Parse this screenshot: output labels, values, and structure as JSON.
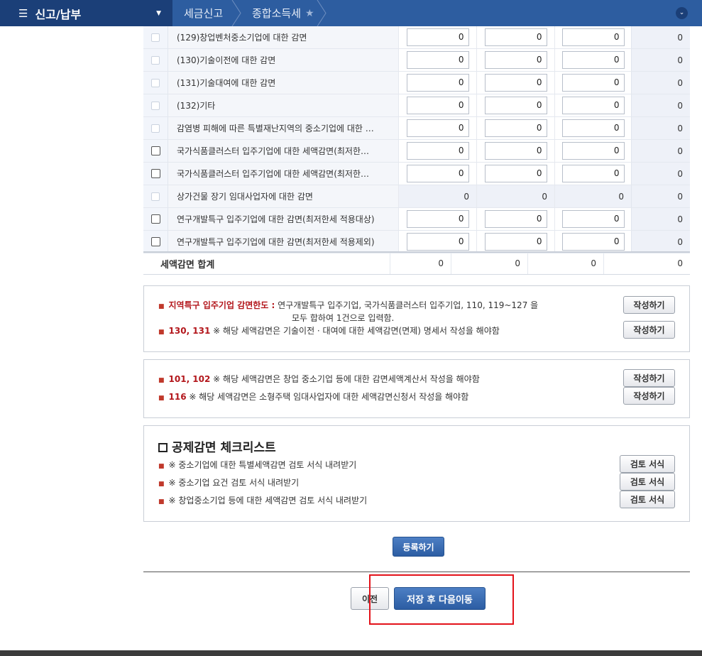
{
  "nav": {
    "menu_label": "신고/납부",
    "crumbs": [
      "세금신고",
      "종합소득세"
    ]
  },
  "rows": [
    {
      "label": "(129)창업벤처중소기업에 대한 감면",
      "checkbox": "disabled",
      "values": [
        "0",
        "0",
        "0"
      ],
      "total": "0"
    },
    {
      "label": "(130)기술이전에 대한 감면",
      "checkbox": "disabled",
      "values": [
        "0",
        "0",
        "0"
      ],
      "total": "0"
    },
    {
      "label": "(131)기술대여에 대한 감면",
      "checkbox": "disabled",
      "values": [
        "0",
        "0",
        "0"
      ],
      "total": "0"
    },
    {
      "label": "(132)기타",
      "checkbox": "disabled",
      "values": [
        "0",
        "0",
        "0"
      ],
      "total": "0"
    },
    {
      "label": "감염병 피해에 따른 특별재난지역의 중소기업에 대한 …",
      "checkbox": "disabled",
      "values": [
        "0",
        "0",
        "0"
      ],
      "total": "0"
    },
    {
      "label": "국가식품클러스터 입주기업에 대한 세액감면(최저한…",
      "checkbox": "enabled",
      "values": [
        "0",
        "0",
        "0"
      ],
      "total": "0"
    },
    {
      "label": "국가식품클러스터 입주기업에 대한 세액감면(최저한…",
      "checkbox": "enabled",
      "values": [
        "0",
        "0",
        "0"
      ],
      "total": "0"
    },
    {
      "label": "상가건물 장기 임대사업자에 대한 감면",
      "checkbox": "disabled",
      "values": [
        "0",
        "0",
        "0"
      ],
      "total": "0",
      "plain": true
    },
    {
      "label": "연구개발특구 입주기업에 대한 감면(최저한세 적용대상)",
      "checkbox": "enabled",
      "values": [
        "0",
        "0",
        "0"
      ],
      "total": "0"
    },
    {
      "label": "연구개발특구 입주기업에 대한 감면(최저한세 적용제외)",
      "checkbox": "enabled",
      "values": [
        "0",
        "0",
        "0"
      ],
      "total": "0"
    }
  ],
  "totals": {
    "label": "세액감면 합계",
    "values": [
      "0",
      "0",
      "0",
      "0"
    ]
  },
  "box1": {
    "note1_red": "지역특구 입주기업 감면한도 :",
    "note1_text": " 연구개발특구 입주기업, 국가식품클러스터 입주기업, 110, 119~127 을",
    "note1_line2": "모두 합하여 1건으로 입력함.",
    "note2_red": "130, 131",
    "note2_text": " ※ 해당 세액감면은 기술이전 · 대여에 대한 세액감면(면제) 명세서 작성을 해야함",
    "button1": "작성하기",
    "button2": "작성하기"
  },
  "box2": {
    "note1_red": "101, 102",
    "note1_text": " ※ 해당 세액감면은 창업 중소기업 등에 대한 감면세액계산서 작성을 해야함",
    "note2_red": "116",
    "note2_text": " ※ 해당 세액감면은 소형주택 임대사업자에 대한 세액감면신청서 작성을 해야함",
    "button1": "작성하기",
    "button2": "작성하기"
  },
  "box3": {
    "title": "공제감면 체크리스트",
    "items": [
      {
        "text": "※ 중소기업에 대한 특별세액감면 검토 서식 내려받기",
        "button": "검토 서식"
      },
      {
        "text": "※ 중소기업 요건 검토 서식 내려받기",
        "button": "검토 서식"
      },
      {
        "text": "※ 창업중소기업 등에 대한 세액감면 검토 서식 내려받기",
        "button": "검토 서식"
      }
    ]
  },
  "actions": {
    "register": "등록하기",
    "prev": "이전",
    "save_next": "저장 후 다음이동"
  }
}
